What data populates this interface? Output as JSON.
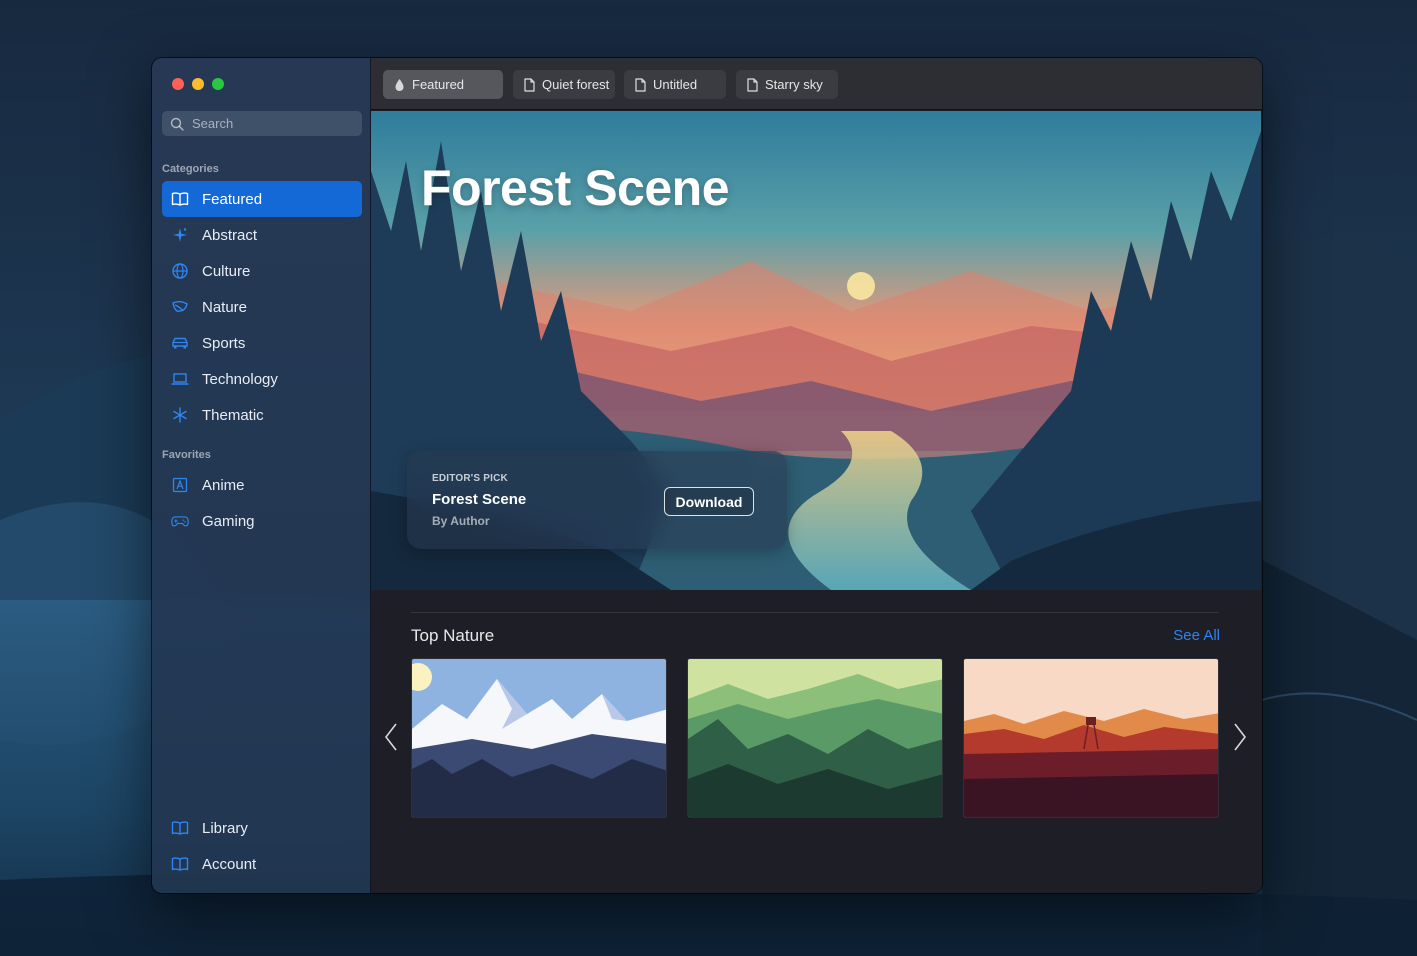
{
  "window": {
    "traffic_lights": {
      "close": "#fe5f57",
      "minimize": "#febc2e",
      "zoom": "#28c840"
    }
  },
  "sidebar": {
    "search_placeholder": "Search",
    "sections": [
      {
        "label": "Categories",
        "items": [
          {
            "label": "Featured",
            "icon": "book-icon",
            "active": true
          },
          {
            "label": "Abstract",
            "icon": "sparkles-icon"
          },
          {
            "label": "Culture",
            "icon": "globe-icon"
          },
          {
            "label": "Nature",
            "icon": "leaf-icon"
          },
          {
            "label": "Sports",
            "icon": "car-icon"
          },
          {
            "label": "Technology",
            "icon": "laptop-icon"
          },
          {
            "label": "Thematic",
            "icon": "snowflake-icon"
          }
        ]
      },
      {
        "label": "Favorites",
        "items": [
          {
            "label": "Anime",
            "icon": "letter-a-icon"
          },
          {
            "label": "Gaming",
            "icon": "gamecontroller-icon"
          }
        ]
      }
    ],
    "bottom_items": [
      {
        "label": "Library",
        "icon": "book-icon"
      },
      {
        "label": "Account",
        "icon": "book-icon"
      }
    ],
    "accent_color": "#1469d6"
  },
  "tabs": [
    {
      "label": "Featured",
      "icon": "drop-icon",
      "active": true
    },
    {
      "label": "Quiet forest",
      "icon": "document-icon"
    },
    {
      "label": "Untitled",
      "icon": "document-icon"
    },
    {
      "label": "Starry sky",
      "icon": "document-icon"
    }
  ],
  "hero": {
    "title": "Forest Scene",
    "card": {
      "label": "EDITOR'S PICK",
      "title": "Forest Scene",
      "author": "By Author",
      "button_label": "Download"
    }
  },
  "top_nature": {
    "title": "Top Nature",
    "see_all_label": "See All",
    "link_color": "#2e82f0",
    "thumbnails": [
      {
        "name": "snowy-mountains"
      },
      {
        "name": "green-valley"
      },
      {
        "name": "red-watchtower"
      }
    ]
  }
}
